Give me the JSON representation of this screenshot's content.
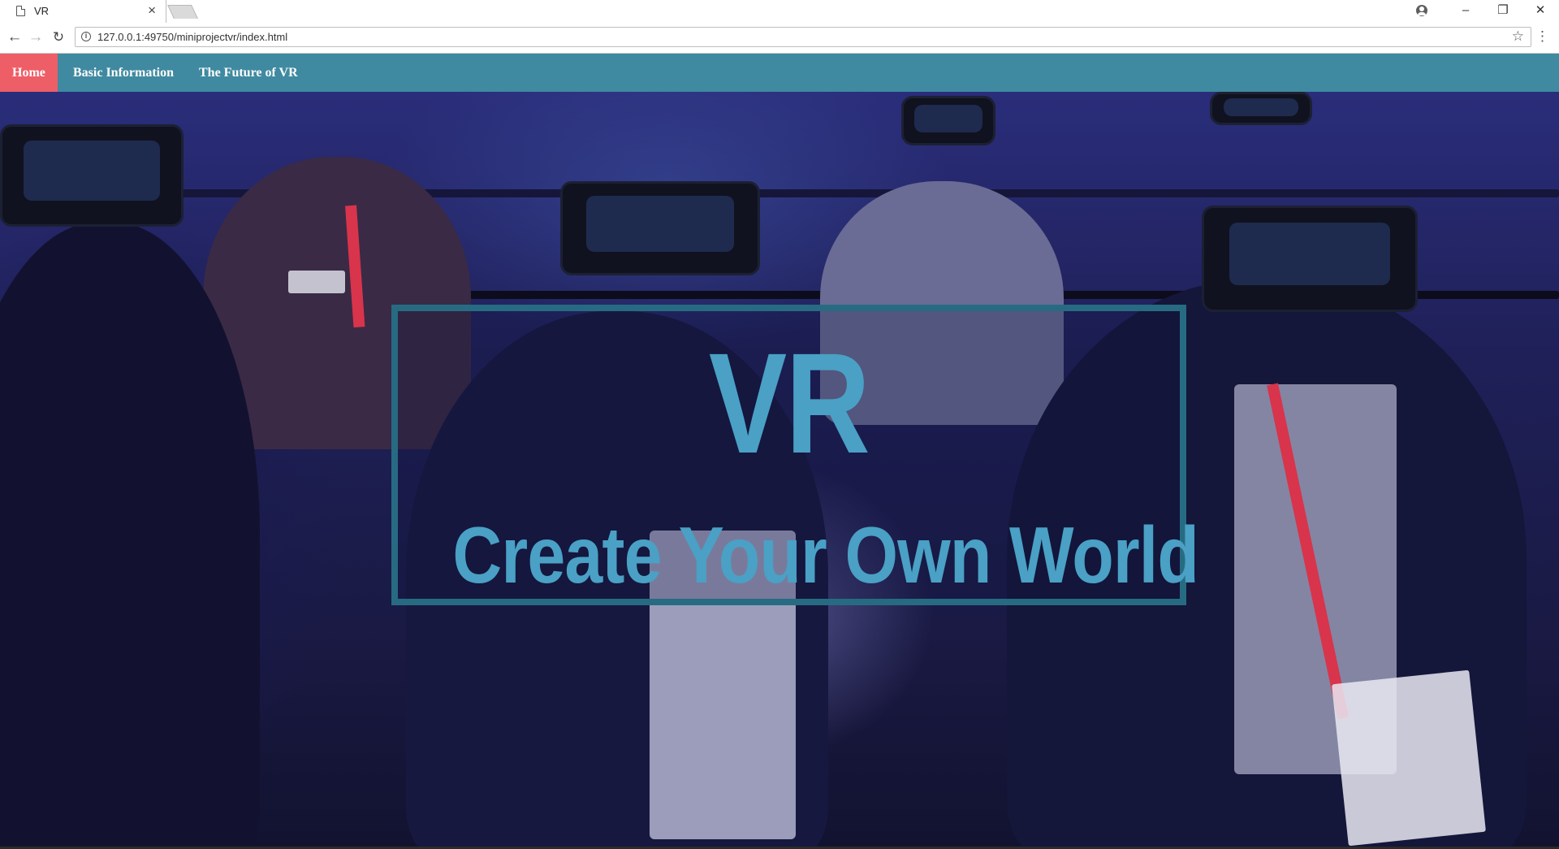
{
  "browser": {
    "tab_title": "VR",
    "tab_close": "×",
    "url": "127.0.0.1:49750/miniprojectvr/index.html",
    "window_controls": {
      "minimize": "–",
      "restore": "❐",
      "close": "✕"
    },
    "icons": [
      "page-icon",
      "profile-icon",
      "back-icon",
      "forward-icon",
      "reload-icon",
      "info-icon",
      "star-icon",
      "menu-icon"
    ]
  },
  "nav": {
    "items": [
      {
        "label": "Home",
        "active": true
      },
      {
        "label": "Basic Information",
        "active": false
      },
      {
        "label": "The Future of VR",
        "active": false
      }
    ],
    "color": "#3f8aa0",
    "active_color": "#ee5e67"
  },
  "hero": {
    "title": "VR",
    "subtitle": "Create Your Own World",
    "text_color": "#4aa0c5",
    "border_color": "#276b83"
  }
}
